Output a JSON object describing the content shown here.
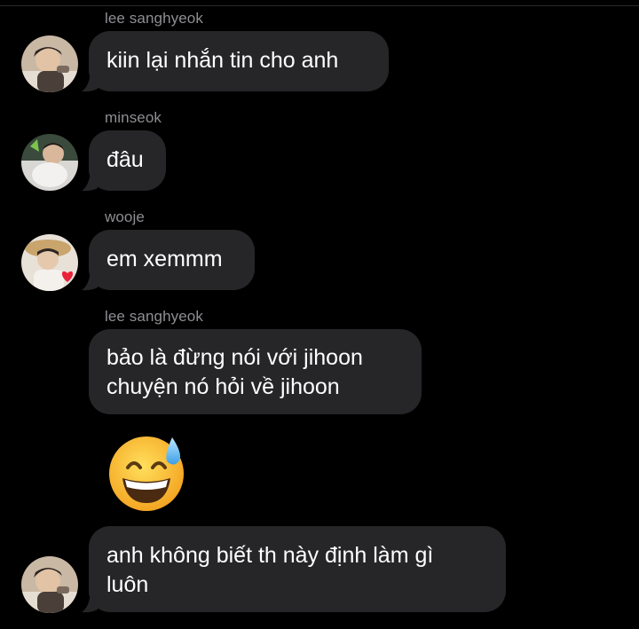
{
  "colors": {
    "background": "#000000",
    "bubble": "#262628",
    "sender_name": "#8e8e93",
    "message_text": "#ffffff"
  },
  "messages": [
    {
      "sender": "lee sanghyeok",
      "lines": [
        "kiin lại nhắn tin cho anh"
      ],
      "avatar": "avatar-lee-sanghyeok"
    },
    {
      "sender": "minseok",
      "lines": [
        "đâu"
      ],
      "avatar": "avatar-minseok"
    },
    {
      "sender": "wooje",
      "lines": [
        "em xemmm"
      ],
      "avatar": "avatar-wooje"
    },
    {
      "sender": "lee sanghyeok",
      "lines": [
        "bảo là đừng nói với jihoon",
        "chuyện nó hỏi về jihoon"
      ]
    },
    {
      "emoji": "grinning-face-with-sweat-emoji"
    },
    {
      "lines": [
        "anh không biết th này định làm gì",
        "luôn"
      ],
      "avatar": "avatar-lee-sanghyeok"
    }
  ]
}
